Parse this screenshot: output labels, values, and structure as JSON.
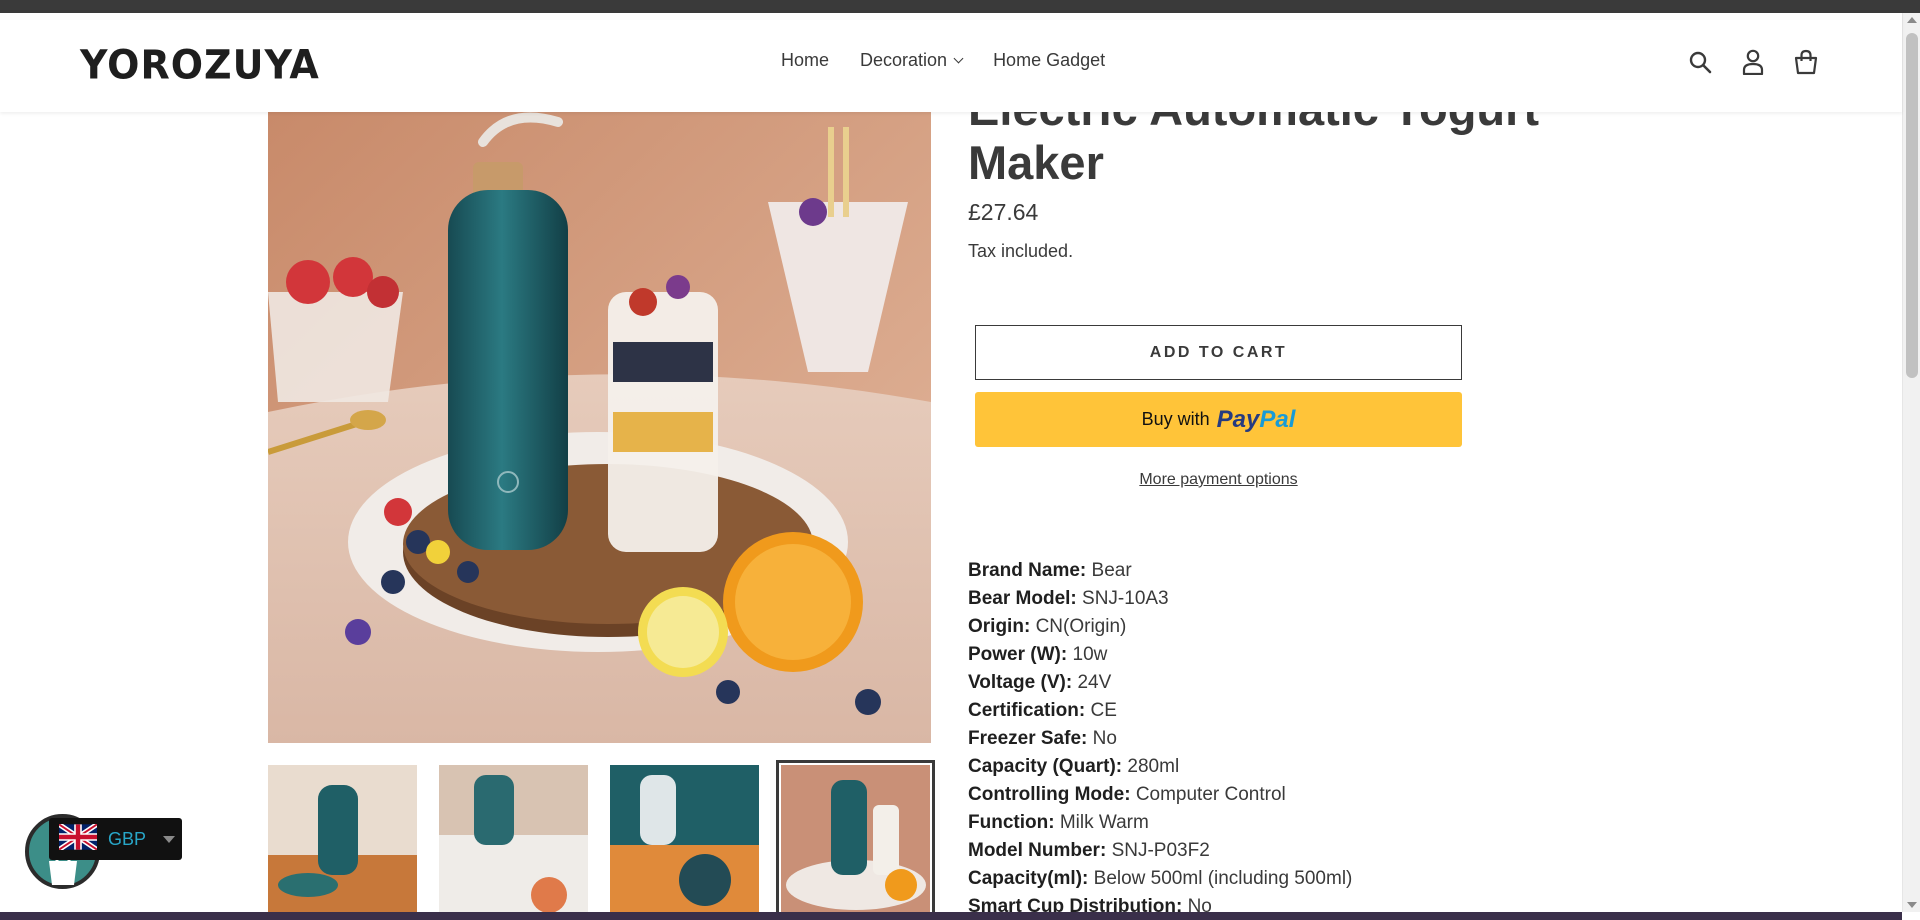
{
  "brand": {
    "logo_text": "YOROZUYA"
  },
  "nav": {
    "items": [
      {
        "label": "Home"
      },
      {
        "label": "Decoration"
      },
      {
        "label": "Home Gadget"
      }
    ]
  },
  "header_icons": [
    "search-icon",
    "account-icon",
    "cart-icon"
  ],
  "product": {
    "title": "Electric Automatic Yogurt Maker",
    "price": "£27.64",
    "tax_note": "Tax included.",
    "add_to_cart": "ADD TO CART",
    "paypal_prefix": "Buy with",
    "paypal_word1": "Pay",
    "paypal_word2": "Pal",
    "more_payment": "More payment options"
  },
  "specs": [
    {
      "label": "Brand Name:",
      "value": "Bear"
    },
    {
      "label": "Bear Model:",
      "value": "SNJ-10A3"
    },
    {
      "label": "Origin:",
      "value": "CN(Origin)"
    },
    {
      "label": "Power (W):",
      "value": "10w"
    },
    {
      "label": "Voltage (V):",
      "value": "24V"
    },
    {
      "label": "Certification:",
      "value": "CE"
    },
    {
      "label": "Freezer Safe:",
      "value": "No"
    },
    {
      "label": "Capacity (Quart):",
      "value": "280ml"
    },
    {
      "label": "Controlling Mode:",
      "value": "Computer Control"
    },
    {
      "label": "Function:",
      "value": "Milk Warm"
    },
    {
      "label": "Model Number:",
      "value": "SNJ-P03F2"
    },
    {
      "label": "Capacity(ml):",
      "value": "Below 500ml (including 500ml)"
    },
    {
      "label": "Smart Cup Distribution:",
      "value": "No"
    }
  ],
  "currency": {
    "code": "GBP",
    "flag": "uk-flag-icon"
  },
  "colors": {
    "paypal_yellow": "#ffc439",
    "text": "#3a3a3a",
    "teal_bottle": "#1f5f66"
  }
}
